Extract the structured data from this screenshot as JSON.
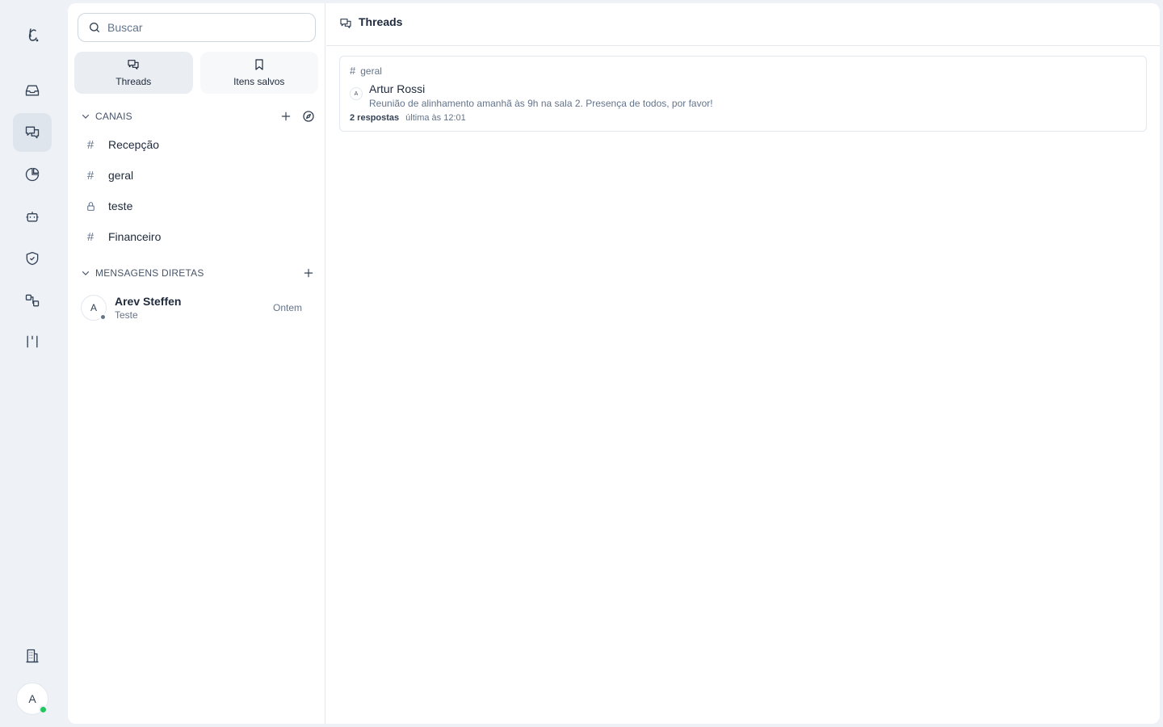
{
  "sidebar": {
    "search_placeholder": "Buscar",
    "tabs": [
      {
        "label": "Threads",
        "icon": "chat-bubbles-icon",
        "active": true
      },
      {
        "label": "Itens salvos",
        "icon": "bookmark-icon",
        "active": false
      }
    ],
    "channels_section": {
      "label": "CANAIS",
      "items": [
        {
          "label": "Recepção",
          "icon": "hash"
        },
        {
          "label": "geral",
          "icon": "hash"
        },
        {
          "label": "teste",
          "icon": "lock"
        },
        {
          "label": "Financeiro",
          "icon": "hash"
        }
      ]
    },
    "dm_section": {
      "label": "MENSAGENS DIRETAS",
      "items": [
        {
          "avatar_initial": "A",
          "name": "Arev Steffen",
          "preview": "Teste",
          "time": "Ontem"
        }
      ]
    }
  },
  "rail": {
    "avatar_initial": "A"
  },
  "main": {
    "title": "Threads",
    "threads": [
      {
        "channel": "geral",
        "author_initial": "A",
        "author": "Artur Rossi",
        "message": "Reunião de alinhamento amanhã às 9h na sala 2. Presença de todos, por favor!",
        "replies": "2 respostas",
        "last_reply": "última às 12:01"
      }
    ]
  },
  "colors": {
    "background": "#eef2f7",
    "panel": "#ffffff",
    "active_tab": "#eaeef2",
    "online": "#22c55e"
  }
}
